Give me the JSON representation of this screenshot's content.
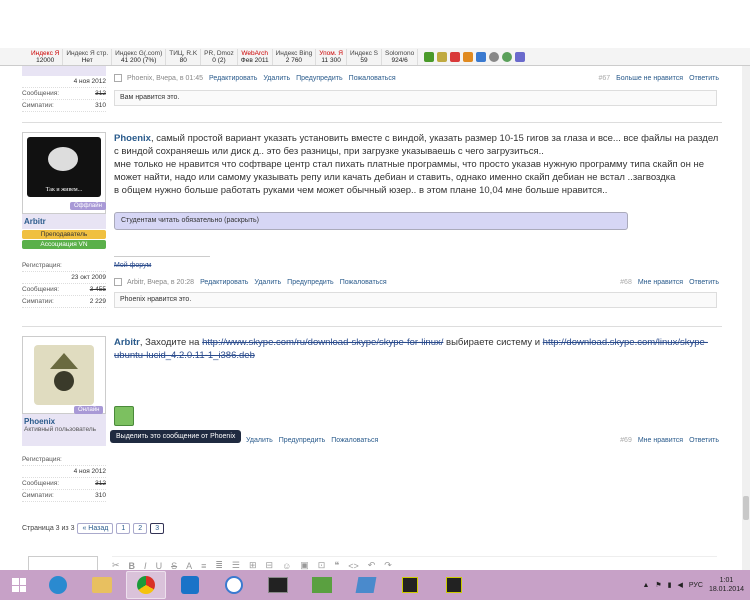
{
  "seo_bar": {
    "items": [
      {
        "t1": "Индекс Я",
        "t2": "12000",
        "red": true
      },
      {
        "t1": "Индекс Я стр.",
        "t2": "Нет",
        "red": false
      },
      {
        "t1": "Индекс G(.com)",
        "t2": "41 200 (7%)",
        "red": false
      },
      {
        "t1": "ТИЦ, R.K",
        "t2": "80",
        "red": false
      },
      {
        "t1": "PR, Dmoz",
        "t2": "0 (2)",
        "red": false
      },
      {
        "t1": "WebArch",
        "t2": "Фев 2011",
        "red": true
      },
      {
        "t1": "Индекс Bing",
        "t2": "2 760",
        "red": false
      },
      {
        "t1": "Упом. Я",
        "t2": "11 300",
        "red": true
      },
      {
        "t1": "Индекс S",
        "t2": "59",
        "red": false
      },
      {
        "t1": "Solomono",
        "t2": "924/6",
        "red": false
      }
    ]
  },
  "post67": {
    "reg_date": "4 ноя 2012",
    "messages_label": "Сообщения:",
    "messages": "312",
    "likes_label": "Симпатии:",
    "likes": "310",
    "footer_meta": "Phoenix, Вчера, в 01:45",
    "actions": [
      "Редактировать",
      "Удалить",
      "Предупредить",
      "Пожаловаться"
    ],
    "num": "#67",
    "right_actions": [
      "Больше не нравится",
      "Ответить"
    ],
    "likes_text": "Вам нравится это."
  },
  "post68": {
    "avatar_text": "Так и живем...",
    "status": "Оффлайн",
    "username": "Arbitr",
    "role1": "Преподаватель",
    "role2": "Ассоциация VN",
    "reg_label": "Регистрация:",
    "reg_date": "23 окт 2009",
    "messages_label": "Сообщения:",
    "messages": "3 455",
    "likes_label": "Симпатии:",
    "likes": "2 229",
    "author": "Phoenix",
    "text": ", самый простой вариант указать установить вместе с виндой, указать размер 10-15 гигов за глаза и все... все файлы на раздел с виндой сохраняешь или диск д.. это без разницы, при загрузке указываешь с чего загрузиться..",
    "text2": "мне только не нравится что софтваре центр стал пихать платные программы, что просто указав нужную программу типа скайп он не может найти, надо или самому указывать репу или качать дебиан и ставить, однако именно скайп дебиан не встал ..загвоздка",
    "text3": "в общем нужно больше работать руками чем может обычный юзер.. в этом плане 10,04 мне больше нравится..",
    "spoiler": "Студентам читать обязательно (раскрыть)",
    "signature": "Мой форум",
    "footer_meta": "Arbitr, Вчера, в 20:28",
    "actions": [
      "Редактировать",
      "Удалить",
      "Предупредить",
      "Пожаловаться"
    ],
    "num": "#68",
    "right_actions": [
      "Мне нравится",
      "Ответить"
    ],
    "likes_text": "Phoenix нравится это."
  },
  "post69": {
    "status": "Онлайн",
    "username": "Phoenix",
    "rank": "Активный пользователь",
    "reg_label": "Регистрация:",
    "reg_date": "4 ноя 2012",
    "messages_label": "Сообщения:",
    "messages": "312",
    "likes_label": "Симпатии:",
    "likes": "310",
    "author": "Arbitr",
    "text_a": ", Заходите на ",
    "link1": "http://www.skype.com/ru/download-skype/skype-for-linux/",
    "text_b": " выбираете систему и ",
    "link2": "http://download.skype.com/linux/skype-ubuntu-lucid_4.2.0.11-1_i386.deb",
    "tooltip": "Выделить это сообщение от Phoenix",
    "actions": [
      "Редактировать",
      "Удалить",
      "Предупредить",
      "Пожаловаться"
    ],
    "num": "#69",
    "right_actions": [
      "Мне нравится",
      "Ответить"
    ]
  },
  "pagination": {
    "label": "Страница 3 из 3",
    "prev": "« Назад",
    "pages": [
      "1",
      "2",
      "3"
    ]
  },
  "editor": {
    "tools": [
      "✂",
      "B",
      "I",
      "U",
      "S",
      "A",
      "≡",
      "≣",
      "☰",
      "⊞",
      "⊟",
      "☺",
      "▣",
      "⊡",
      "❝",
      "<>",
      "↶",
      "↷"
    ]
  },
  "tray": {
    "lang": "РУС",
    "time": "1:01",
    "date": "18.01.2014"
  }
}
